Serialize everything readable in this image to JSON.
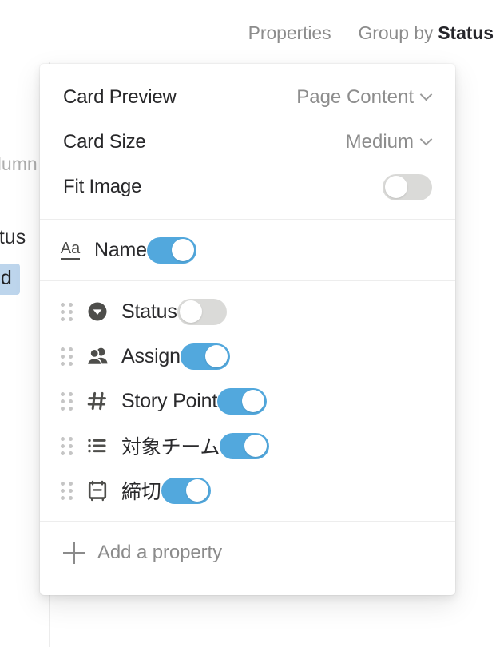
{
  "topbar": {
    "properties_label": "Properties",
    "group_by_label": "Group by",
    "group_by_value": "Status"
  },
  "background": {
    "column_label": "olumn",
    "status_label": "tatus",
    "status_chip": "ted"
  },
  "popup": {
    "settings": [
      {
        "label": "Card Preview",
        "value": "Page Content",
        "control": "select"
      },
      {
        "label": "Card Size",
        "value": "Medium",
        "control": "select"
      },
      {
        "label": "Fit Image",
        "value": "off",
        "control": "toggle"
      }
    ],
    "name_row": {
      "icon": "title-aa-icon",
      "icon_text": "Aa",
      "label": "Name",
      "toggle": "on"
    },
    "properties": [
      {
        "icon": "select-chevron-circle-icon",
        "label": "Status",
        "toggle": "off"
      },
      {
        "icon": "people-icon",
        "label": "Assign",
        "toggle": "on"
      },
      {
        "icon": "number-hash-icon",
        "label": "Story Point",
        "toggle": "on"
      },
      {
        "icon": "multi-select-list-icon",
        "label": "対象チーム",
        "toggle": "on"
      },
      {
        "icon": "calendar-date-icon",
        "label": "締切",
        "toggle": "on"
      }
    ],
    "add_property": {
      "icon": "plus-icon",
      "label": "Add a property"
    }
  },
  "colors": {
    "toggle_on": "#52a8dd",
    "toggle_off": "#dadad8",
    "chip_bg": "#bdd5ec",
    "text_primary": "#272729",
    "text_muted": "#8b8b8b"
  }
}
